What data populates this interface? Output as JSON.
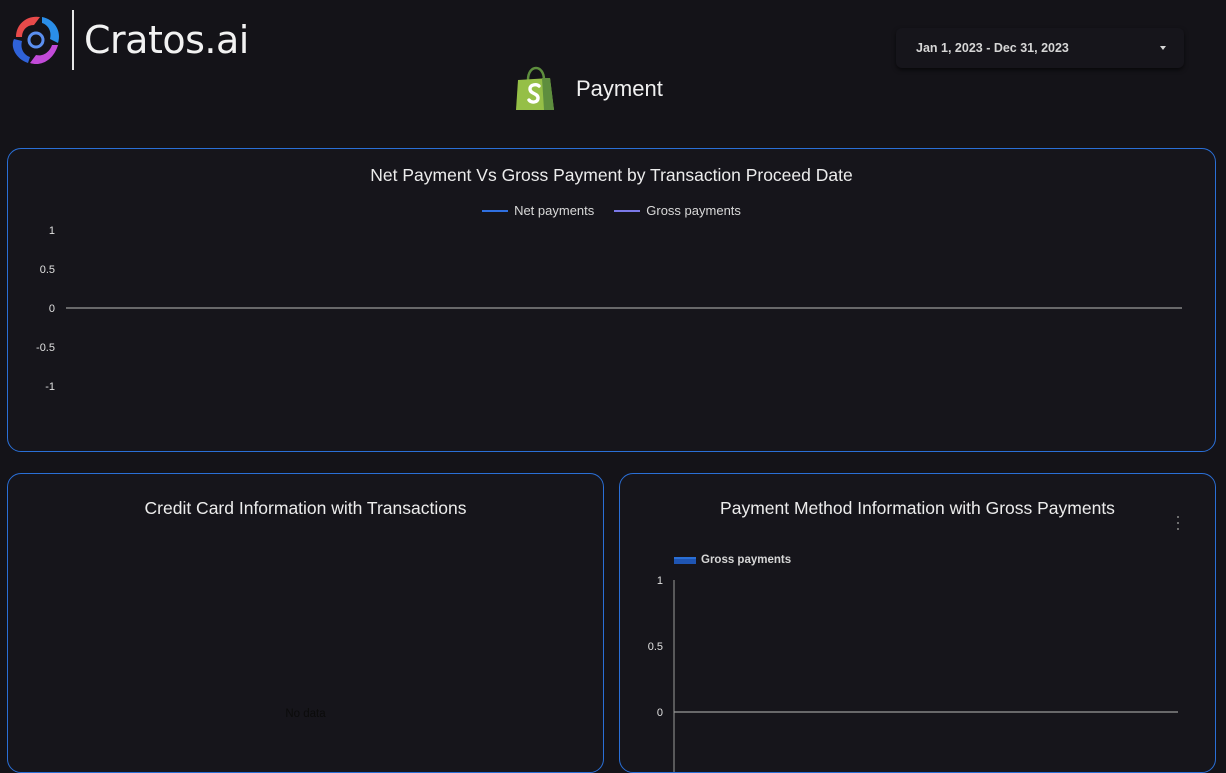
{
  "brand": {
    "name": "Cratos.ai",
    "logo_icon": "cratos-logo-icon"
  },
  "date_range": {
    "value": "Jan 1, 2023 - Dec 31, 2023",
    "icon": "caret-down-icon"
  },
  "page": {
    "title": "Payment",
    "icon": "shopify-bag-icon"
  },
  "colors": {
    "accent_border": "#2a6fd6",
    "net_line": "#2f6fe0",
    "gross_line": "#7b79e8",
    "bar_gross": "#1f55b3",
    "background": "#141318"
  },
  "charts": {
    "net_vs_gross": {
      "title": "Net Payment Vs Gross Payment by Transaction Proceed Date"
    },
    "credit_card": {
      "title": "Credit Card Information with Transactions",
      "empty_text": "No data"
    },
    "payment_method": {
      "title": "Payment Method Information with Gross Payments",
      "menu_icon": "kebab-menu-icon"
    }
  },
  "chart_data": [
    {
      "type": "line",
      "title": "Net Payment Vs Gross Payment by Transaction Proceed Date",
      "series": [
        {
          "name": "Net payments",
          "values": []
        },
        {
          "name": "Gross payments",
          "values": []
        }
      ],
      "yticks": [
        "1",
        "0.5",
        "0",
        "-0.5",
        "-1"
      ],
      "ylim": [
        -1,
        1
      ],
      "legend_position": "top"
    },
    {
      "type": "table",
      "title": "Credit Card Information with Transactions",
      "rows": [],
      "empty_text": "No data"
    },
    {
      "type": "bar",
      "title": "Payment Method Information with Gross Payments",
      "series": [
        {
          "name": "Gross payments",
          "values": []
        }
      ],
      "yticks": [
        "1",
        "0.5",
        "0"
      ],
      "ylim": [
        0,
        1
      ],
      "legend_position": "top-left"
    }
  ]
}
